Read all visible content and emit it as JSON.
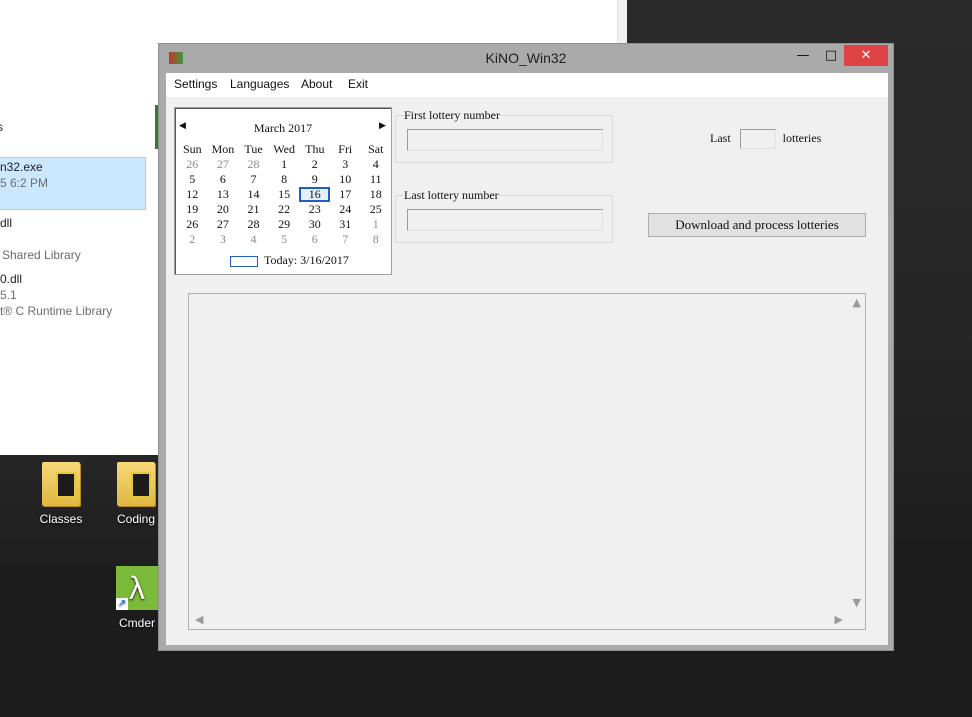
{
  "explorer": {
    "items": [
      {
        "name": "s",
        "sub": ""
      },
      {
        "name": "n32.exe",
        "sub": "5 6:2 PM"
      },
      {
        "name": "dll",
        "sub": ""
      },
      {
        "name": "",
        "sub": "Shared Library"
      },
      {
        "name": "0.dll",
        "sub": "5.1"
      },
      {
        "name": "",
        "sub": "t® C Runtime Library"
      }
    ]
  },
  "desktop": {
    "icons": [
      {
        "label": "Classes",
        "icon": "folder-icon"
      },
      {
        "label": "Coding",
        "icon": "folder-icon"
      },
      {
        "label": "Cmder",
        "icon": "cmder-lambda-icon"
      }
    ]
  },
  "window": {
    "title": "KiNO_Win32",
    "controls": {
      "minimize": "—",
      "maximize": "□",
      "close": "✕"
    },
    "menu": [
      "Settings",
      "Languages",
      "About",
      "Exit"
    ]
  },
  "calendar": {
    "month_label": "March 2017",
    "prev": "◀",
    "next": "▶",
    "weekdays": [
      "Sun",
      "Mon",
      "Tue",
      "Wed",
      "Thu",
      "Fri",
      "Sat"
    ],
    "weeks": [
      [
        "26",
        "27",
        "28",
        "1",
        "2",
        "3",
        "4"
      ],
      [
        "5",
        "6",
        "7",
        "8",
        "9",
        "10",
        "11"
      ],
      [
        "12",
        "13",
        "14",
        "15",
        "16",
        "17",
        "18"
      ],
      [
        "19",
        "20",
        "21",
        "22",
        "23",
        "24",
        "25"
      ],
      [
        "26",
        "27",
        "28",
        "29",
        "30",
        "31",
        "1"
      ],
      [
        "2",
        "3",
        "4",
        "5",
        "6",
        "7",
        "8"
      ]
    ],
    "selected": "16",
    "today_label": "Today: 3/16/2017"
  },
  "form": {
    "first_label": "First lottery number",
    "first_value": "",
    "last_label": "Last lottery number",
    "last_value": "",
    "last_prefix": "Last",
    "last_count": "",
    "last_suffix": "lotteries",
    "download_button": "Download and process lotteries"
  },
  "output": {
    "text": ""
  },
  "colors": {
    "close_button": "#e04343",
    "selection": "#cce8ff",
    "calendar_focus": "#1e5fbf"
  }
}
